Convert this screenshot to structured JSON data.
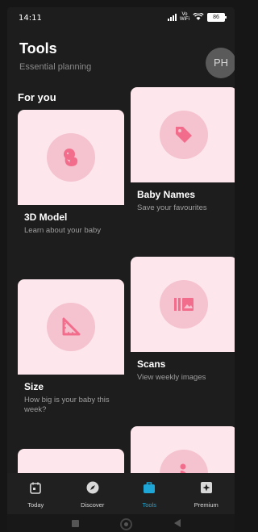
{
  "status": {
    "time": "14:11",
    "volte": "Vo\nWiFi",
    "battery": "86"
  },
  "header": {
    "title": "Tools",
    "subtitle": "Essential planning",
    "avatar_initials": "PH"
  },
  "section_title": "For you",
  "cards": [
    {
      "name": "3D Model",
      "desc": "Learn about your baby",
      "icon": "baby-embryo-icon"
    },
    {
      "name": "Baby Names",
      "desc": "Save your favourites",
      "icon": "tag-icon"
    },
    {
      "name": "Size",
      "desc": "How big is your baby this week?",
      "icon": "ruler-triangle-icon"
    },
    {
      "name": "Scans",
      "desc": "View weekly images",
      "icon": "scan-images-icon"
    },
    {
      "name": "",
      "desc": "",
      "icon": ""
    },
    {
      "name": "",
      "desc": "",
      "icon": "pregnant-person-icon"
    }
  ],
  "nav": [
    {
      "label": "Today",
      "icon": "calendar-icon",
      "active": false
    },
    {
      "label": "Discover",
      "icon": "compass-icon",
      "active": false
    },
    {
      "label": "Tools",
      "icon": "toolbox-icon",
      "active": true
    },
    {
      "label": "Premium",
      "icon": "sparkle-icon",
      "active": false
    }
  ],
  "colors": {
    "accent": "#1ea7d6",
    "tile": "#fde6ec",
    "icon_circle": "#f5c2cf",
    "icon": "#f26d8c"
  }
}
